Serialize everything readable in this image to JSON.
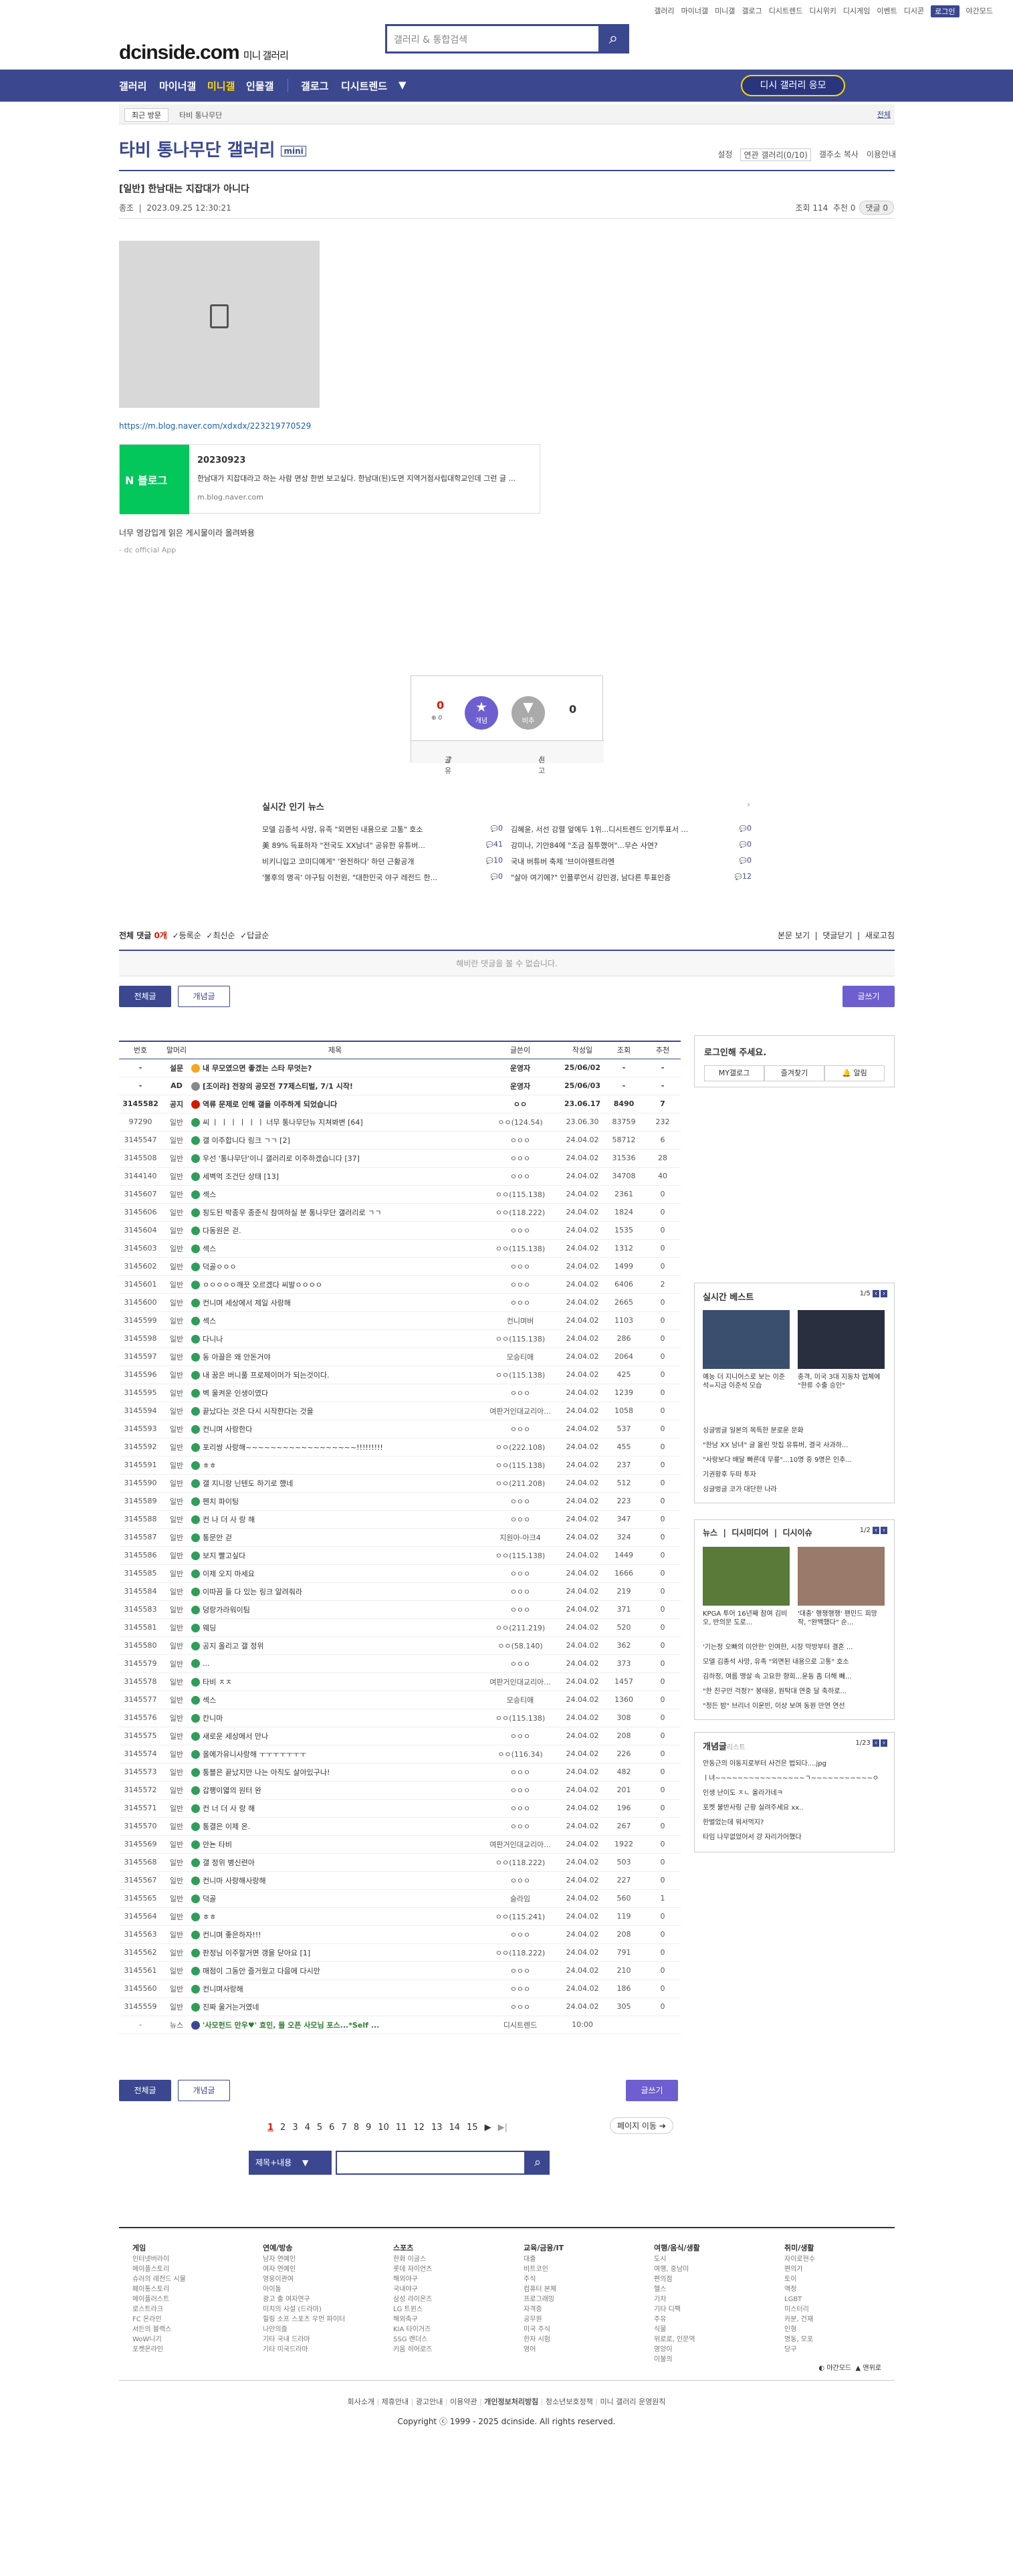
{
  "top_links": [
    "갤러리",
    "마이너갤",
    "미니갤",
    "갤로그",
    "디시트렌드",
    "디시위키",
    "디시게임",
    "이벤트",
    "디시콘"
  ],
  "login": "로그인",
  "dark_mode": "야간모드",
  "logo": {
    "main": "dcinside.com",
    "sub": "미니 갤러리"
  },
  "search": {
    "placeholder": "갤러리 & 통합검색"
  },
  "gnb": {
    "items": [
      "갤러리",
      "마이너갤",
      "미니갤",
      "인물갤",
      "갤로그",
      "디시트렌드"
    ],
    "apply": "디시 갤러리 응모"
  },
  "crumb": {
    "recent": "최근 방문",
    "gallery": "타비 통나무단",
    "all": "전체"
  },
  "gallery": {
    "title": "타비 통나무단 갤러리",
    "mini": "mini",
    "tools": [
      "설정",
      "연관 갤러리(0/10)",
      "갤주소 복사",
      "이용안내"
    ]
  },
  "post": {
    "title": "[일반] 한남대는 지잡대가 아니다",
    "author": "종조",
    "date": "2023.09.25 12:30:21",
    "views": "조회 114",
    "recommend": "추천 0",
    "comments": "댓글 0",
    "link": "https://m.blog.naver.com/xdxdx/223219770529",
    "card": {
      "badge": "블로그",
      "title": "20230923",
      "desc": "한남대가 지잡대라고 하는 사람 면상 한번 보고싶다. 한남대(된)도면 지역거점사립대학교인데 그런 글 ...",
      "domain": "m.blog.naver.com"
    },
    "text": "너무 영강입게 읽은 게시물이라 올려봐용",
    "signature": "- dc official App"
  },
  "vote": {
    "up_count": "0",
    "up_sub": "0",
    "up_label": "개념",
    "down_label": "비추",
    "down_count": "0",
    "share": "공유",
    "report": "신고"
  },
  "news": {
    "title": "실시간 인기 뉴스",
    "items": [
      {
        "t": "모델 김종석 사망, 유족 \"외면된 내용으로 고통\" 호소",
        "c": "0"
      },
      {
        "t": "김혜윤, 서선 강렬 앞에두 1위...디시트렌드 인기투표서 ...",
        "c": "0"
      },
      {
        "t": "美 89% 득표하자 \"전국도 XX남녀\" 공유한 유튜버...",
        "c": "41"
      },
      {
        "t": "강미나, 기안84에 \"조금 질투했어\"...무슨 사연?",
        "c": "0"
      },
      {
        "t": "비키니입고 코미디예게\" '완전하다' 하던 근황공개",
        "c": "10"
      },
      {
        "t": "국내 버튜버 축제 '브이아웬트라멘",
        "c": "0"
      },
      {
        "t": "'불후의 명곡' 야구팀 이천원, \"대한민국 야구 레전드 한...",
        "c": "0"
      },
      {
        "t": "\"살아 여기에?\" 인플루언서 강민경, 남다른 투표인증",
        "c": "12"
      }
    ]
  },
  "comment_bar": {
    "label": "전체 댓글",
    "count": "0개",
    "sort1": "등록순",
    "sort2": "최신순",
    "sort3": "답글순",
    "r1": "본문 보기",
    "r2": "댓글닫기",
    "r3": "새로고침",
    "empty": "해비란 댓글을 볼 수 없습니다."
  },
  "buttons": {
    "all": "전체글",
    "concept": "개념글",
    "write": "글쓰기"
  },
  "list_headers": [
    "번호",
    "말머리",
    "제목",
    "글쓴이",
    "작성일",
    "조회",
    "추천"
  ],
  "rows": [
    [
      "-",
      "설문",
      "내 무모였으면 좋겠는 스타 무엇는?",
      "운영자",
      "25/06/02",
      "-",
      "-",
      "N"
    ],
    [
      "-",
      "AD",
      "[조이라] 전장의 공모전 77제스티벌, 7/1 시작!",
      "운영자",
      "25/06/03",
      "-",
      "-",
      "N"
    ],
    [
      "3145582",
      "공지",
      "역류 문제로 인해 갤을 이주하게 되었습니다",
      "ㅇㅇ",
      "23.06.17",
      "8490",
      "7",
      ""
    ],
    [
      "97290",
      "일반",
      "씨 ㅣ ㅣ ㅣ ㅣ ㅣ ㅣ 너무 통나무단뉴 지쳐봐변 [64]",
      "ㅇㅇ(124.54)",
      "23.06.30",
      "83759",
      "232",
      ""
    ],
    [
      "3145547",
      "일반",
      "갤 이주합니다 링크 ㄱㄱ [2]",
      "ㅇㅇㅇ",
      "24.04.02",
      "58712",
      "6",
      ""
    ],
    [
      "3145508",
      "일반",
      "우선 '통나무단'이니 갤러리로 이주하겠습니다 [37]",
      "ㅇㅇㅇ",
      "24.04.02",
      "31536",
      "28",
      ""
    ],
    [
      "3144140",
      "일반",
      "세벽먹 조건단 상태 [13]",
      "ㅇㅇㅇ",
      "24.04.02",
      "34708",
      "40",
      ""
    ],
    [
      "3145607",
      "일반",
      "섹스",
      "ㅇㅇ(115.138)",
      "24.04.02",
      "2361",
      "0",
      ""
    ],
    [
      "3145606",
      "일반",
      "핑도된 박종우 종준식 참여하실 분 통나무단 갤러리로 ㄱㄱ",
      "ㅇㅇ(118.222)",
      "24.04.02",
      "1824",
      "0",
      ""
    ],
    [
      "3145604",
      "일반",
      "다동원은 걷.",
      "ㅇㅇㅇ",
      "24.04.02",
      "1535",
      "0",
      ""
    ],
    [
      "3145603",
      "일반",
      "섹스",
      "ㅇㅇ(115.138)",
      "24.04.02",
      "1312",
      "0",
      ""
    ],
    [
      "3145602",
      "일반",
      "덕골ㅇㅇㅇ",
      "ㅇㅇㅇ",
      "24.04.02",
      "1499",
      "0",
      ""
    ],
    [
      "3145601",
      "일반",
      "ㅇㅇㅇㅇㅇ깨끗 오르겠다 씨발ㅇㅇㅇㅇ",
      "ㅇㅇㅇ",
      "24.04.02",
      "6406",
      "2",
      ""
    ],
    [
      "3145600",
      "일반",
      "컨니며 세상에서 제일 사랑해",
      "ㅇㅇㅇ",
      "24.04.02",
      "2665",
      "0",
      ""
    ],
    [
      "3145599",
      "일반",
      "섹스",
      "컨니며버",
      "24.04.02",
      "1103",
      "0",
      ""
    ],
    [
      "3145598",
      "일반",
      "다니나",
      "ㅇㅇ(115.138)",
      "24.04.02",
      "286",
      "0",
      ""
    ],
    [
      "3145597",
      "일반",
      "동 아끌은 왜 안돈거야",
      "모승티애",
      "24.04.02",
      "2064",
      "0",
      ""
    ],
    [
      "3145596",
      "일반",
      "내 꿈은 버니풀 프로제이머가 되는것이다.",
      "ㅇㅇ(115.138)",
      "24.04.02",
      "425",
      "0",
      ""
    ],
    [
      "3145595",
      "일반",
      "벽 울켜운 인생이였다",
      "ㅇㅇㅇ",
      "24.04.02",
      "1239",
      "0",
      ""
    ],
    [
      "3145594",
      "일반",
      "끝났다는 것은 다시 시작한다는 것을",
      "여판거인대교리아...",
      "24.04.02",
      "1058",
      "0",
      ""
    ],
    [
      "3145593",
      "일반",
      "컨니며 사랑한다",
      "ㅇㅇㅇ",
      "24.04.02",
      "537",
      "0",
      ""
    ],
    [
      "3145592",
      "일반",
      "포리쌍 사랑해~~~~~~~~~~~~~~~~~~!!!!!!!!!",
      "ㅇㅇ(222.108)",
      "24.04.02",
      "455",
      "0",
      ""
    ],
    [
      "3145591",
      "일반",
      "ㅎㅎ",
      "ㅇㅇ(115.138)",
      "24.04.02",
      "237",
      "0",
      ""
    ],
    [
      "3145590",
      "일반",
      "갤 지니랑 닌텐도 하기로 했네",
      "ㅇㅇ(211.208)",
      "24.04.02",
      "512",
      "0",
      ""
    ],
    [
      "3145589",
      "일반",
      "펜치 파이팅",
      "ㅇㅇㅇ",
      "24.04.02",
      "223",
      "0",
      ""
    ],
    [
      "3145588",
      "일반",
      "컨 나 더 사 랑 해",
      "ㅇㅇㅇ",
      "24.04.02",
      "347",
      "0",
      ""
    ],
    [
      "3145587",
      "일반",
      "통문안 걷",
      "지원아-아크4",
      "24.04.02",
      "324",
      "0",
      ""
    ],
    [
      "3145586",
      "일반",
      "보지 빨고싶다",
      "ㅇㅇ(115.138)",
      "24.04.02",
      "1449",
      "0",
      ""
    ],
    [
      "3145585",
      "일반",
      "이제 오지 마세요",
      "ㅇㅇㅇ",
      "24.04.02",
      "1666",
      "0",
      ""
    ],
    [
      "3145584",
      "일반",
      "이따끔 들 다 있는 링크 알려줘라",
      "ㅇㅇㅇ",
      "24.04.02",
      "219",
      "0",
      ""
    ],
    [
      "3145583",
      "일반",
      "덩랑가라워이팀",
      "ㅇㅇㅇ",
      "24.04.02",
      "371",
      "0",
      ""
    ],
    [
      "3145581",
      "일반",
      "웨딩",
      "ㅇㅇ(211.219)",
      "24.04.02",
      "520",
      "0",
      ""
    ],
    [
      "3145580",
      "일반",
      "공지 올리고 갤 정위",
      "ㅇㅇ(58.140)",
      "24.04.02",
      "362",
      "0",
      ""
    ],
    [
      "3145579",
      "일반",
      "...",
      "ㅇㅇㅇ",
      "24.04.02",
      "373",
      "0",
      ""
    ],
    [
      "3145578",
      "일반",
      "타비 ㅈㅈ",
      "여판거인대교리아...",
      "24.04.02",
      "1457",
      "0",
      ""
    ],
    [
      "3145577",
      "일반",
      "섹스",
      "모승티애",
      "24.04.02",
      "1360",
      "0",
      ""
    ],
    [
      "3145576",
      "일반",
      "칸니마",
      "ㅇㅇ(115.138)",
      "24.04.02",
      "308",
      "0",
      ""
    ],
    [
      "3145575",
      "일반",
      "새로운 세상에서 만나",
      "ㅇㅇㅇ",
      "24.04.02",
      "208",
      "0",
      ""
    ],
    [
      "3145574",
      "일반",
      "올에가유니사랑해 ㅜㅜㅜㅜㅜㅜㅜ",
      "ㅇㅇ(116.34)",
      "24.04.02",
      "226",
      "0",
      ""
    ],
    [
      "3145573",
      "일반",
      "통블은 끝났지만 나는 아직도 살아있구나!",
      "ㅇㅇㅇ",
      "24.04.02",
      "482",
      "0",
      ""
    ],
    [
      "3145572",
      "일반",
      "갑팽이엷의 원터 완",
      "ㅇㅇㅇ",
      "24.04.02",
      "201",
      "0",
      ""
    ],
    [
      "3145571",
      "일반",
      "컨 너 더 사 랑 해",
      "ㅇㅇㅇ",
      "24.04.02",
      "196",
      "0",
      ""
    ],
    [
      "3145570",
      "일반",
      "통결은 이제 온.",
      "ㅇㅇㅇ",
      "24.04.02",
      "267",
      "0",
      ""
    ],
    [
      "3145569",
      "일반",
      "안뇬 타비",
      "여판거인대교리아...",
      "24.04.02",
      "1922",
      "0",
      ""
    ],
    [
      "3145568",
      "일반",
      "갤 정위 병신련아",
      "ㅇㅇ(118.222)",
      "24.04.02",
      "503",
      "0",
      ""
    ],
    [
      "3145567",
      "일반",
      "컨니마 사랑해사랑해",
      "ㅇㅇㅇ",
      "24.04.02",
      "227",
      "0",
      ""
    ],
    [
      "3145565",
      "일반",
      "덕골",
      "슬라임",
      "24.04.02",
      "560",
      "1",
      ""
    ],
    [
      "3145564",
      "일반",
      "ㅎㅎ",
      "ㅇㅇ(115.241)",
      "24.04.02",
      "119",
      "0",
      ""
    ],
    [
      "3145563",
      "일반",
      "컨니며 좋은하자!!!",
      "ㅇㅇㅇ",
      "24.04.02",
      "208",
      "0",
      ""
    ],
    [
      "3145562",
      "일반",
      "판정님 이주할거면 갱을 닫아요 [1]",
      "ㅇㅇ(118.222)",
      "24.04.02",
      "791",
      "0",
      ""
    ],
    [
      "3145561",
      "일반",
      "매점이 그동안 즐거웠고 다음에 다시만",
      "ㅇㅇㅇ",
      "24.04.02",
      "210",
      "0",
      ""
    ],
    [
      "3145560",
      "일반",
      "컨니며사랑해",
      "ㅇㅇㅇ",
      "24.04.02",
      "186",
      "0",
      ""
    ],
    [
      "3145559",
      "일반",
      "진짜 울거는거였네",
      "ㅇㅇㅇ",
      "24.04.02",
      "305",
      "0",
      ""
    ],
    [
      "-",
      "뉴스",
      "'사모펀드 만우♥' 효민, 몰 오픈 사모님 포스...*Self ...",
      "디시트렌드",
      "10:00",
      "",
      "",
      ""
    ]
  ],
  "sidebar": {
    "login": {
      "title": "로그인해 주세요.",
      "b1": "MY갤로그",
      "b2": "즐겨찾기",
      "b3": "알림"
    },
    "best": {
      "title": "실시간 베스트",
      "page": "1/5",
      "cap1": "예능 더 지니어스로 보는 이준석=지금 이준석 모습",
      "cap2": "충격, 미국 3대 지동차 업체에 \"한류 수출 승인\"",
      "items": [
        "싱글벙글 일본의 목특한 분로운 문화",
        "\"한남 XX 남녀\" 글 올린 맛집 유튜버, 결국 사과하...",
        "\"사랑보다 배달 빠른데 무릎\"...10명 중 9명은 인추...",
        "기권황후 두떠 투자",
        "싱글벙글 코가 대단한 나라"
      ]
    },
    "news": {
      "t1": "뉴스",
      "t2": "디시미디어",
      "t3": "디시이슈",
      "page": "1/2",
      "cap1": "KPGA 투어 16년째 참여 김비오, 반의문 도로...",
      "cap2": "'대충' 행쟁행쟁' 팬민드 희망작, \"완백했다\" 순...",
      "items": [
        "'기는정 오빠의 미안한' 인여한, 시장 막방부터 결혼 ...",
        "모델 김종석 사망, 유족 \"외면된 내용으로 고통\" 호소",
        "김하정, 여름 맹살 속 고요한 향희...운동 좀 더해 빼...",
        "\"한 친구만 걱정?\" 봉태윤, 원탁대 연중 달 축하로...",
        "\"정든 밤\" 브리너 이운빈, 이상 보며 동원 만연 연선"
      ]
    },
    "concept": {
      "title": "개념글",
      "sub": "리스트",
      "page": "1/23",
      "items": [
        "안동근의 이동지로부터 사건은 법되다....jpg",
        "ㅣ녀~~~~~~~~~~~~~~~~ㄱ~~~~~~~~~~~ㅇ",
        "인생 난이도 ㅈㄴ 올라가네ㅋ",
        "포켓 불반사링 근황 실려주세요 xx..",
        "한벌었는데 워서먹지?",
        "타임 나무없었어서 걍 자리가어했다"
      ]
    }
  },
  "pager": {
    "pages": [
      "1",
      "2",
      "3",
      "4",
      "5",
      "6",
      "7",
      "8",
      "9",
      "10",
      "11",
      "12",
      "13",
      "14",
      "15"
    ],
    "current": "1",
    "move": "페이지 이동"
  },
  "search_bottom": {
    "select": "제목+내용",
    "placeholder": ""
  },
  "footer": {
    "cols": [
      {
        "h": "게임",
        "i": [
          "인터넷버라이",
          "메이플스토리",
          "슈러의 레전드 시뮬",
          "페이통스토리",
          "메이플러스트",
          "로스트라크",
          "FC 온라인",
          "서든의 블랙스",
          "WoW니기",
          "포켓온라인"
        ]
      },
      {
        "h": "연예/방송",
        "i": [
          "남자 연예인",
          "여자 연예인",
          "영웅이관여",
          "아이돌",
          "광고 출 여자연구",
          "미치의 사설 (드라마)",
          "힐링 소프 스포츠 우먼 파이터",
          "나만의즐",
          "기타 국내 드라마",
          "기타 미국드라마"
        ]
      },
      {
        "h": "스포츠",
        "i": [
          "한화 이글스",
          "롯데 자이언츠",
          "해외야구",
          "국내야구",
          "삼성 라이온즈",
          "LG 트윈스",
          "해외축구",
          "KIA 타이거즈",
          "SSG 랜더스",
          "키움 히어로즈"
        ]
      },
      {
        "h": "교육/금융/IT",
        "i": [
          "대출",
          "비트코인",
          "주식",
          "컴퓨터 본체",
          "프로그래밍",
          "자격증",
          "공무원",
          "미국 주식",
          "한자 시험",
          "영어"
        ]
      },
      {
        "h": "여행/음식/생활",
        "i": [
          "도시",
          "여행, 중남미",
          "편의점",
          "헬스",
          "기차",
          "기타 디팩",
          "주유",
          "식물",
          "위로로, 인문역",
          "영양이",
          "이불의"
        ]
      },
      {
        "h": "취미/생활",
        "i": [
          "자이로현수",
          "편의가",
          "토이",
          "액정",
          "LGBT",
          "미스터리",
          "카분, 건재",
          "인형",
          "명동, 모포",
          "당구"
        ]
      }
    ],
    "dark": "야간모드",
    "top": "맨위로",
    "links": [
      "회사소개",
      "제휴안내",
      "광고안내",
      "이용약관",
      "개인정보처리방침",
      "청소년보호정책",
      "미니 갤러리 운영원칙"
    ],
    "copyright": "Copyright ⓒ 1999 - 2025 dcinside. All rights reserved."
  }
}
